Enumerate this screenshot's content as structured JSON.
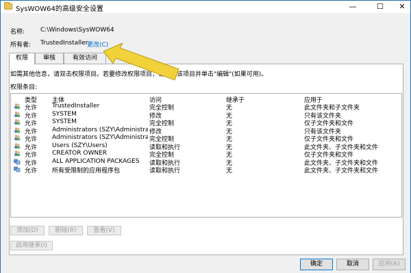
{
  "window": {
    "title": "SysWOW64的高级安全设置",
    "minimize": "—",
    "maximize": "☐",
    "close": "✕"
  },
  "info": {
    "name_label": "名称:",
    "name_value": "C:\\Windows\\SysWOW64",
    "owner_label": "所有者:",
    "owner_value": "TrustedInstaller",
    "change_link": "更改(C)"
  },
  "tabs": [
    "权限",
    "审核",
    "有效访问"
  ],
  "instructions": "如需其他信息，请双击权限项目。若要修改权限项目，请选择该项目并单击\"编辑\"(如果可用)。",
  "entries_label": "权限条目:",
  "columns": [
    "类型",
    "主体",
    "访问",
    "继承于",
    "应用于"
  ],
  "rows": [
    {
      "type": "允许",
      "principal": "TrustedInstaller",
      "access": "完全控制",
      "inherited": "无",
      "applies": "此文件夹和子文件夹"
    },
    {
      "type": "允许",
      "principal": "SYSTEM",
      "access": "修改",
      "inherited": "无",
      "applies": "只有该文件夹"
    },
    {
      "type": "允许",
      "principal": "SYSTEM",
      "access": "完全控制",
      "inherited": "无",
      "applies": "仅子文件夹和文件"
    },
    {
      "type": "允许",
      "principal": "Administrators (SZY\\Administrators)",
      "access": "修改",
      "inherited": "无",
      "applies": "只有该文件夹"
    },
    {
      "type": "允许",
      "principal": "Administrators (SZY\\Administrators)",
      "access": "完全控制",
      "inherited": "无",
      "applies": "仅子文件夹和文件"
    },
    {
      "type": "允许",
      "principal": "Users (SZY\\Users)",
      "access": "读取和执行",
      "inherited": "无",
      "applies": "此文件夹、子文件夹和文件"
    },
    {
      "type": "允许",
      "principal": "CREATOR OWNER",
      "access": "完全控制",
      "inherited": "无",
      "applies": "仅子文件夹和文件"
    },
    {
      "type": "允许",
      "principal": "ALL APPLICATION PACKAGES",
      "access": "读取和执行",
      "inherited": "无",
      "applies": "此文件夹、子文件夹和文件"
    },
    {
      "type": "允许",
      "principal": "所有受限制的应用程序包",
      "access": "读取和执行",
      "inherited": "无",
      "applies": "此文件夹、子文件夹和文件"
    }
  ],
  "row_icons": [
    "users-icon",
    "users-icon",
    "users-icon",
    "users-icon",
    "users-icon",
    "users-icon",
    "users-icon",
    "packages-icon",
    "packages-icon"
  ],
  "buttons": {
    "add": "添加(D)",
    "remove": "删除(R)",
    "view": "查看(V)",
    "enable_inheritance": "启用继承(I)"
  },
  "footer": {
    "ok": "确定",
    "cancel": "取消",
    "apply": "应用(A)"
  },
  "colors": {
    "accent": "#0078d7",
    "link": "#0066cc",
    "arrow": "#f2d23a"
  }
}
